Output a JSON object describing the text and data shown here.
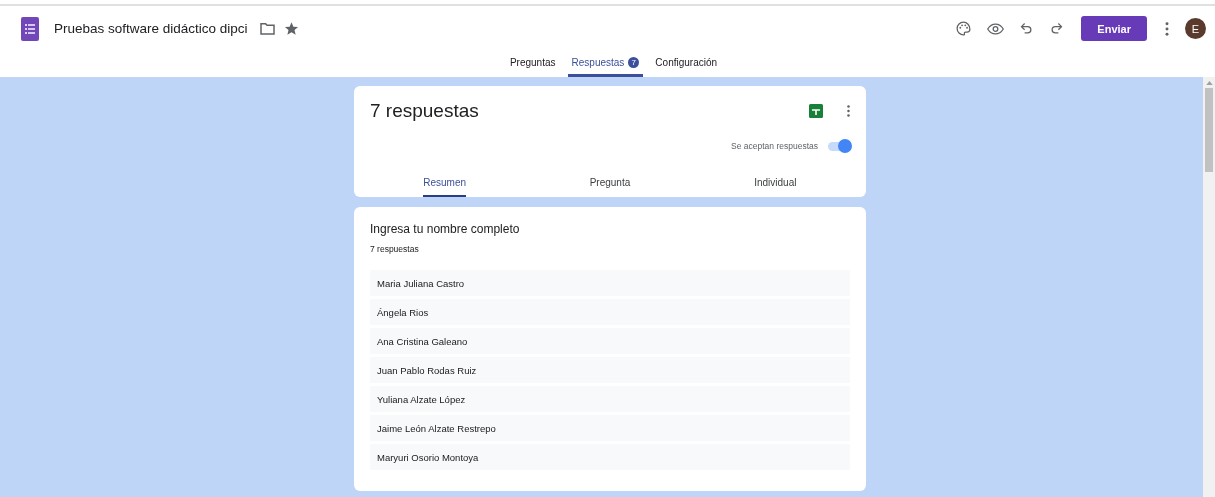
{
  "header": {
    "title": "Pruebas software didáctico dipci",
    "send_button": "Enviar",
    "avatar": "E"
  },
  "tabs": [
    {
      "label": "Preguntas",
      "selected": false
    },
    {
      "label": "Respuestas",
      "badge": "7",
      "selected": true
    },
    {
      "label": "Configuración",
      "selected": false
    }
  ],
  "summary": {
    "title": "7 respuestas",
    "accepting_label": "Se aceptan respuestas",
    "accepting": true,
    "view_tabs": [
      {
        "label": "Resumen",
        "selected": true
      },
      {
        "label": "Pregunta",
        "selected": false
      },
      {
        "label": "Individual",
        "selected": false
      }
    ]
  },
  "question": {
    "title": "Ingresa tu nombre completo",
    "count": "7 respuestas",
    "answers": [
      "Maria Juliana Castro",
      "Ángela Rios",
      "Ana Cristina Galeano",
      "Juan Pablo Rodas Ruiz",
      "Yuliana Alzate López",
      "Jaime León Alzate Restrepo",
      "Maryuri Osorio Montoya"
    ]
  }
}
